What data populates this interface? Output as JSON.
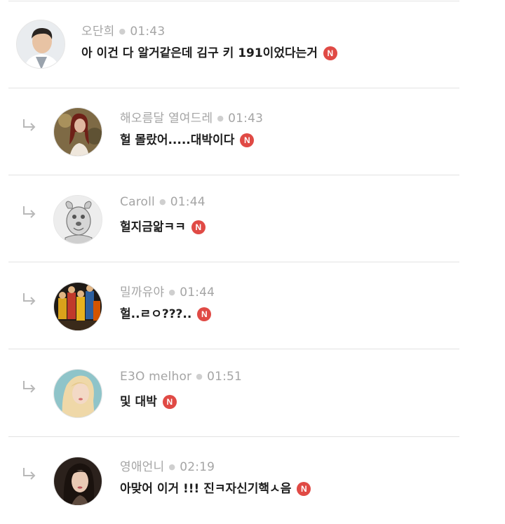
{
  "new_badge": "N",
  "comments": [
    {
      "author": "오단희",
      "time": "01:43",
      "text": "아 이건 다 알거같은데 김구 키 191이었다는거",
      "avatar": "avatar-man-suit"
    },
    {
      "author": "해오름달 열여드레",
      "time": "01:43",
      "text": "헐 몰랐어.....대박이다",
      "avatar": "avatar-woman-red-hair"
    },
    {
      "author": "Caroll",
      "time": "01:44",
      "text": "헐지금앎ㅋㅋ",
      "avatar": "avatar-cartoon-dog"
    },
    {
      "author": "밀까유야",
      "time": "01:44",
      "text": "헐..ㄹㅇ???..",
      "avatar": "avatar-colorful-group"
    },
    {
      "author": "E3O melhor",
      "time": "01:51",
      "text": "및 대박",
      "avatar": "avatar-blonde-woman"
    },
    {
      "author": "영애언니",
      "time": "02:19",
      "text": "아맞어 이거 !!! 진ㅋ자신기핵ㅅ음",
      "avatar": "avatar-dark-hair-woman"
    }
  ],
  "colors": {
    "badge": "#e04a45",
    "meta": "#a5a5a5",
    "text": "#1e1e1e",
    "divider": "#e2e2e2"
  }
}
